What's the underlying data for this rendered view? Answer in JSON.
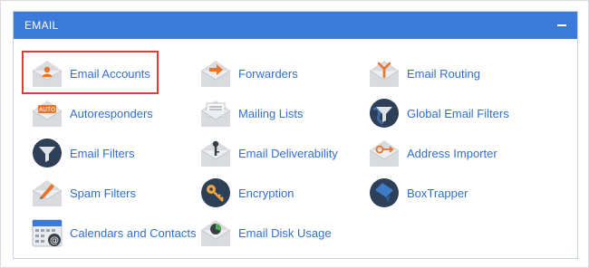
{
  "section": {
    "title": "EMAIL",
    "collapse_icon": "minus-icon"
  },
  "colors": {
    "header": "#3b7ad9",
    "link": "#2f6fcf",
    "highlight": "#e03a3a"
  },
  "items": [
    {
      "label": "Email Accounts",
      "icon": "email-accounts-icon",
      "highlighted": true
    },
    {
      "label": "Forwarders",
      "icon": "forwarders-icon"
    },
    {
      "label": "Email Routing",
      "icon": "email-routing-icon"
    },
    {
      "label": "Autoresponders",
      "icon": "autoresponders-icon"
    },
    {
      "label": "Mailing Lists",
      "icon": "mailing-lists-icon"
    },
    {
      "label": "Global Email Filters",
      "icon": "global-email-filters-icon"
    },
    {
      "label": "Email Filters",
      "icon": "email-filters-icon"
    },
    {
      "label": "Email Deliverability",
      "icon": "email-deliverability-icon"
    },
    {
      "label": "Address Importer",
      "icon": "address-importer-icon"
    },
    {
      "label": "Spam Filters",
      "icon": "spam-filters-icon"
    },
    {
      "label": "Encryption",
      "icon": "encryption-icon"
    },
    {
      "label": "BoxTrapper",
      "icon": "boxtrapper-icon"
    },
    {
      "label": "Calendars and Contacts",
      "icon": "calendars-contacts-icon"
    },
    {
      "label": "Email Disk Usage",
      "icon": "email-disk-usage-icon"
    }
  ]
}
